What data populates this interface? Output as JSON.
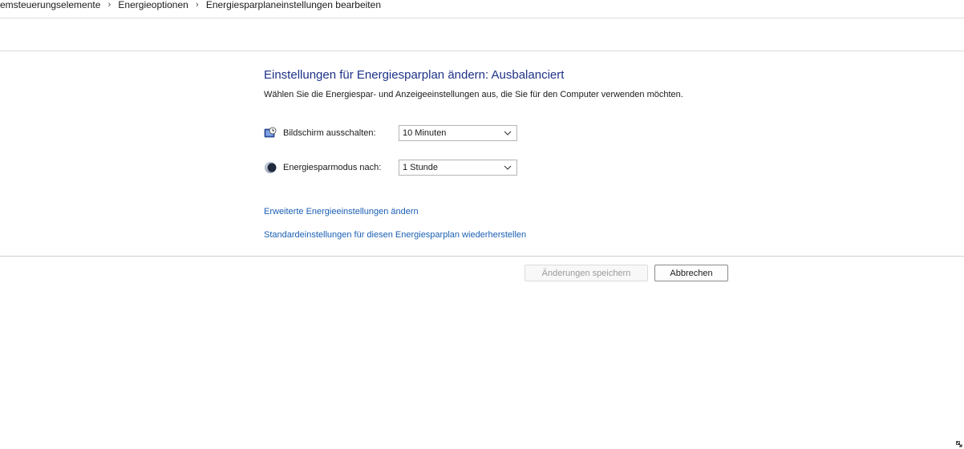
{
  "breadcrumb": {
    "items": [
      "emsteuerungselemente",
      "Energieoptionen",
      "Energiesparplaneinstellungen bearbeiten"
    ],
    "separator": "›"
  },
  "main": {
    "title": "Einstellungen für Energiesparplan ändern: Ausbalanciert",
    "subtitle": "Wählen Sie die Energiespar- und Anzeigeeinstellungen aus, die Sie für den Computer verwenden möchten.",
    "settings": [
      {
        "label": "Bildschirm ausschalten:",
        "value": "10 Minuten",
        "icon": "monitor-clock-icon"
      },
      {
        "label": "Energiesparmodus nach:",
        "value": "1 Stunde",
        "icon": "moon-sleep-icon"
      }
    ],
    "links": {
      "advanced": "Erweiterte Energieeinstellungen ändern",
      "restore": "Standardeinstellungen für diesen Energiesparplan wiederherstellen"
    }
  },
  "buttons": {
    "save": "Änderungen speichern",
    "cancel": "Abbrechen"
  },
  "colors": {
    "title": "#1e3287",
    "link": "#1a5fb4",
    "disabled_text": "#9a9a9a"
  }
}
